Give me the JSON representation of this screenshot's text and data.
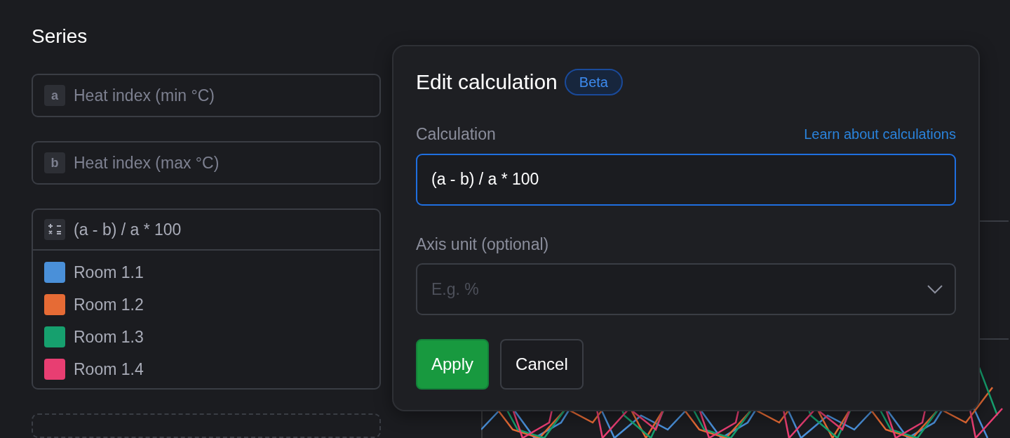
{
  "panel": {
    "title": "Series",
    "series": [
      {
        "kind": "variable",
        "letter": "a",
        "label": "Heat index (min °C)"
      },
      {
        "kind": "variable",
        "letter": "b",
        "label": "Heat index (max °C)"
      },
      {
        "kind": "calculation",
        "label": "(a - b) / a * 100",
        "legend": [
          {
            "name": "Room 1.1",
            "color": "#4a90d9"
          },
          {
            "name": "Room 1.2",
            "color": "#e66b35"
          },
          {
            "name": "Room 1.3",
            "color": "#16a06e"
          },
          {
            "name": "Room 1.4",
            "color": "#e83e72"
          }
        ]
      }
    ]
  },
  "popover": {
    "title": "Edit calculation",
    "badge": "Beta",
    "calculation_label": "Calculation",
    "help_link": "Learn about calculations",
    "calculation_value": "(a - b) / a * 100",
    "unit_label": "Axis unit (optional)",
    "unit_placeholder": "E.g. %",
    "buttons": [
      {
        "kind": "primary",
        "label": "Apply"
      },
      {
        "kind": "secondary",
        "label": "Cancel"
      }
    ]
  }
}
